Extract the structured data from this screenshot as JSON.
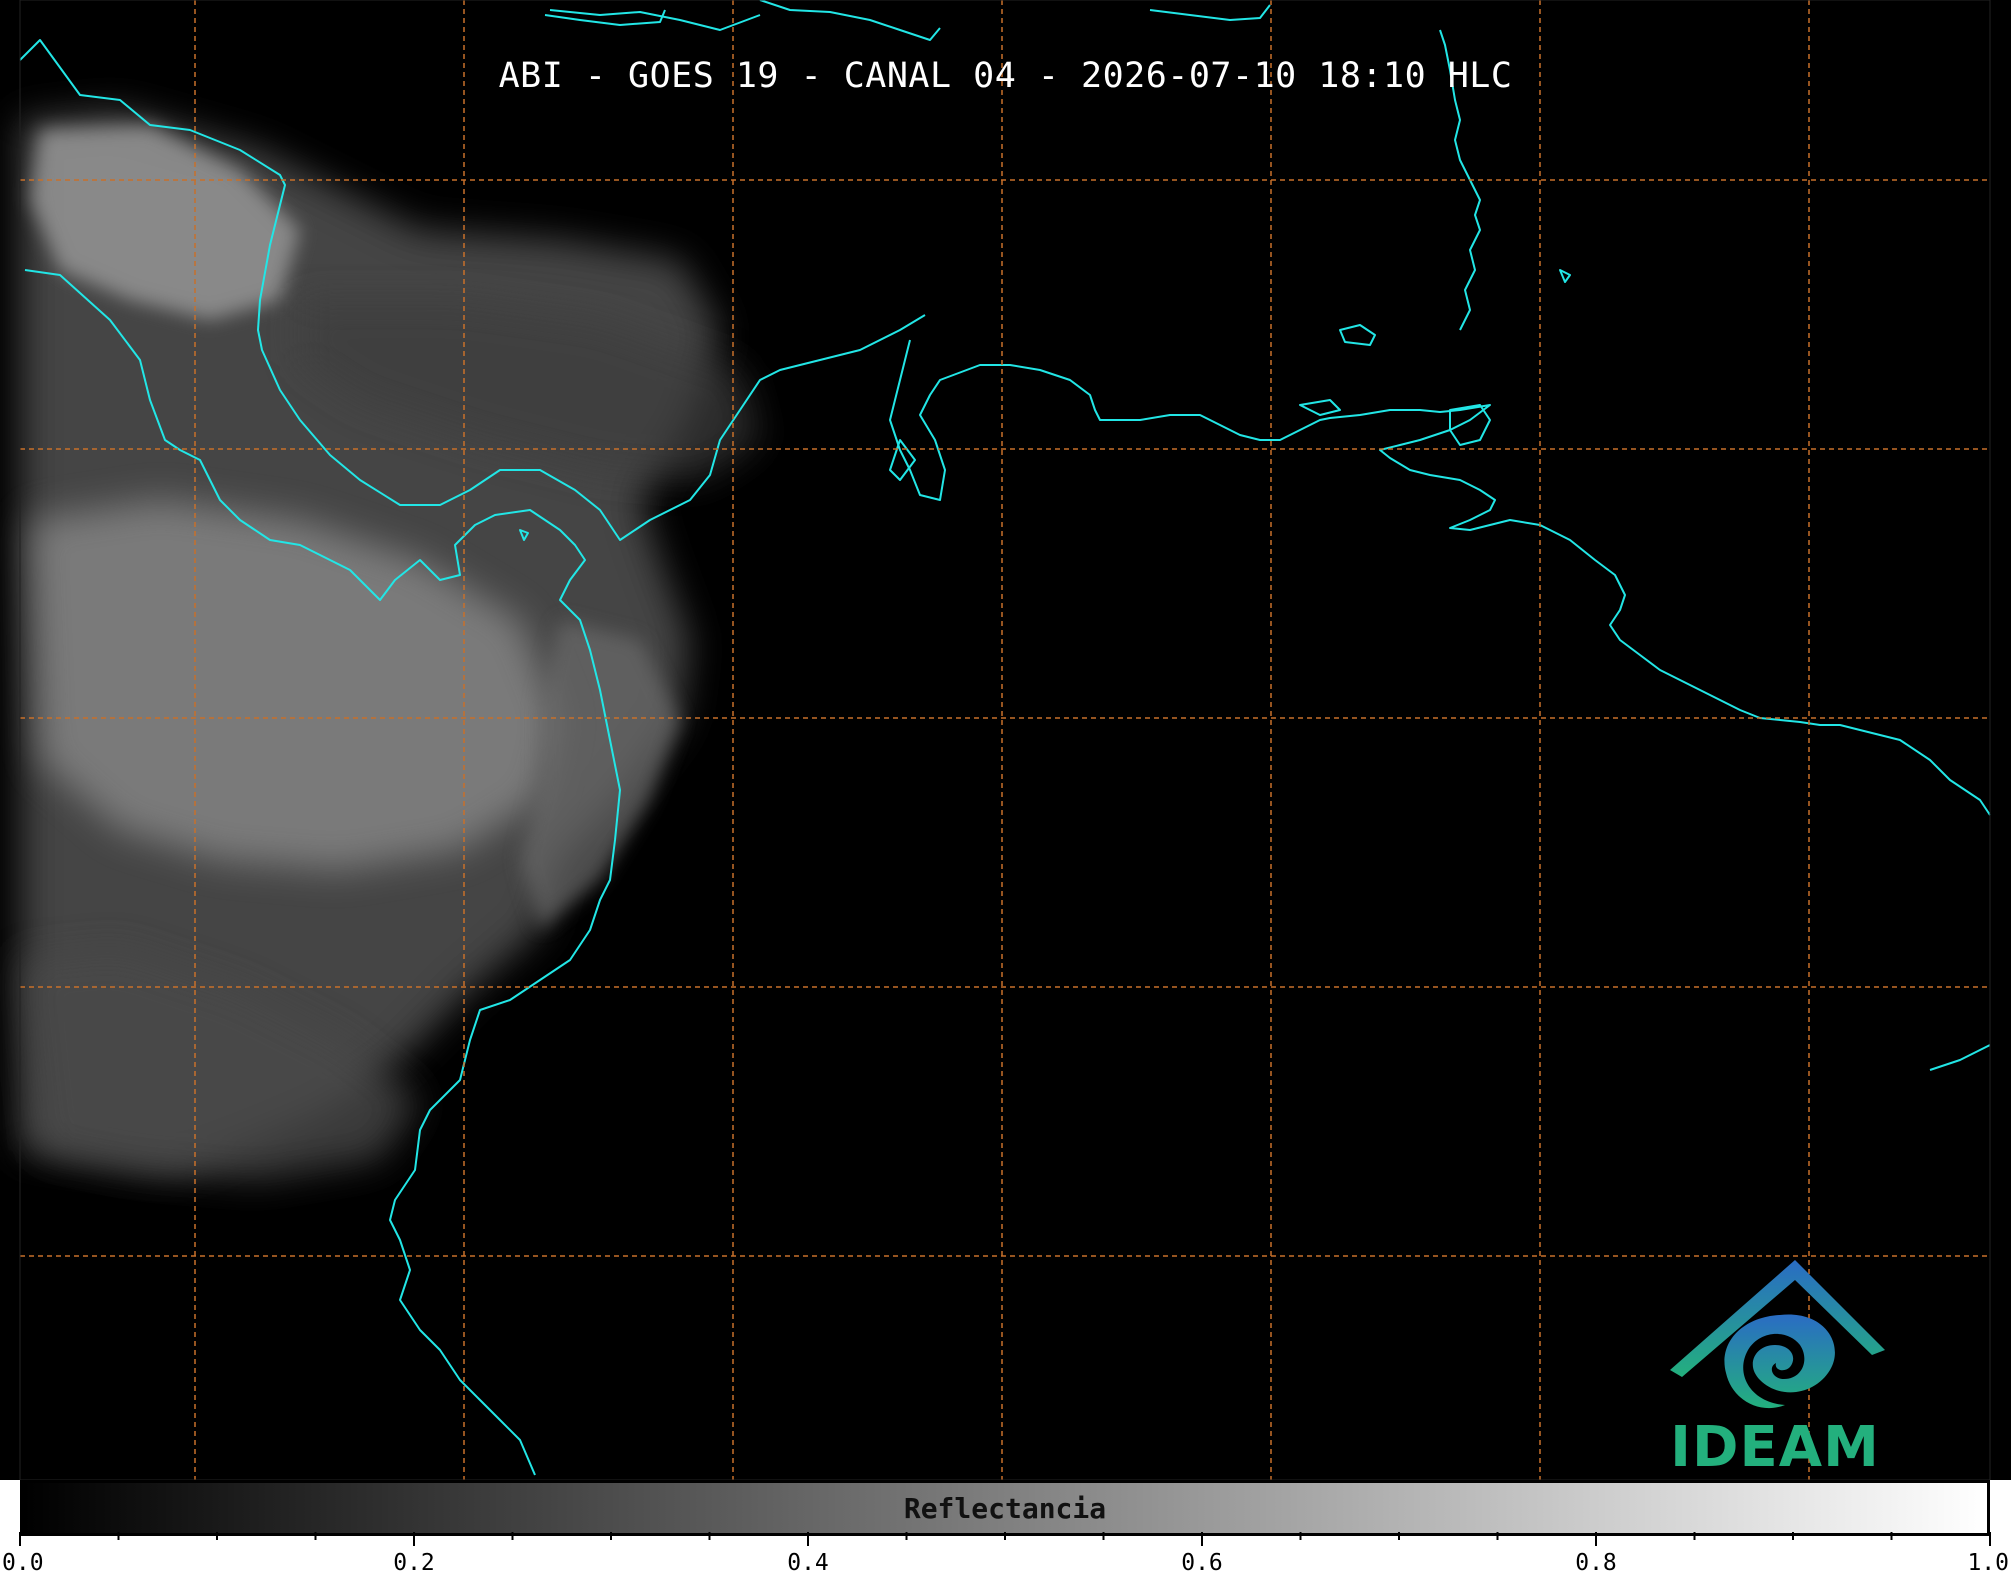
{
  "map": {
    "title": "ABI - GOES 19 - CANAL 04 - 2026-07-10 18:10 HLC",
    "background_color": "#000000",
    "coastline_color": "#22e6e6",
    "grid_color": "#c8702a",
    "grid_style": "dashed",
    "cloud_color": "#8a8a8a"
  },
  "logo": {
    "text": "IDEAM",
    "icon": "ideam-logo-icon",
    "colors": [
      "#2a6cc4",
      "#23b07d"
    ]
  },
  "colorbar": {
    "label": "Reflectancia",
    "range": [
      0.0,
      1.0
    ],
    "major_ticks": [
      0.0,
      0.2,
      0.4,
      0.6,
      0.8,
      1.0
    ],
    "tick_labels": [
      "0.0",
      "0.2",
      "0.4",
      "0.6",
      "0.8",
      "1.0"
    ],
    "colors": [
      "#000000",
      "#ffffff"
    ]
  }
}
